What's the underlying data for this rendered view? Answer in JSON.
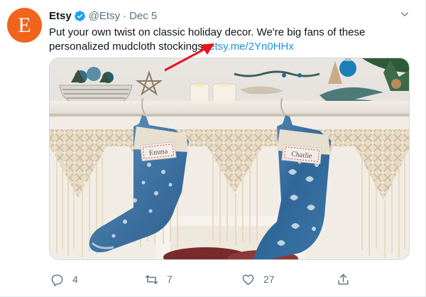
{
  "tweet": {
    "avatar_letter": "E",
    "avatar_color": "#f1641e",
    "name": "Etsy",
    "handle": "@Etsy",
    "separator": "·",
    "date": "Dec 5",
    "text": "Put your own twist on classic holiday decor. We're big fans of these personalized mudcloth stockings: ",
    "link": "etsy.me/2Yn0HHx",
    "link_color": "#1b95e0"
  },
  "media": {
    "stocking_left_tag": "Emma",
    "stocking_right_tag": "Charlie"
  },
  "actions": {
    "reply_count": "4",
    "retweet_count": "7",
    "like_count": "27"
  },
  "annotation": {
    "arrow_color": "#e8141a"
  }
}
